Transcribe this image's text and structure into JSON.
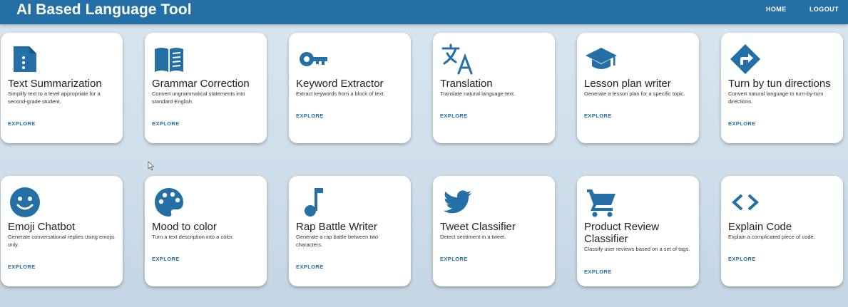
{
  "header": {
    "title": "AI Based Language Tool",
    "nav": {
      "home": "HOME",
      "logout": "LOGOUT"
    },
    "color": "#2470a6"
  },
  "cards": [
    {
      "icon": "document-list-icon",
      "title": "Text Summarization",
      "description": "Simplify text to a level appropriate for a second-grade student.",
      "action": "EXPLORE"
    },
    {
      "icon": "open-book-icon",
      "title": "Grammar Correction",
      "description": "Convert ungrammatical statements into standard English.",
      "action": "EXPLORE"
    },
    {
      "icon": "key-icon",
      "title": "Keyword Extractor",
      "description": "Extract keywords from a block of text.",
      "action": "EXPLORE"
    },
    {
      "icon": "translate-icon",
      "title": "Translation",
      "description": "Translate natural language text.",
      "action": "EXPLORE"
    },
    {
      "icon": "graduation-cap-icon",
      "title": "Lesson plan writer",
      "description": "Generate a lesson plan for a specific topic.",
      "action": "EXPLORE"
    },
    {
      "icon": "directions-icon",
      "title": "Turn by tun directions",
      "description": "Convert natural language to turn-by-turn directions.",
      "action": "EXPLORE"
    },
    {
      "icon": "smiley-face-icon",
      "title": "Emoji Chatbot",
      "description": "Generate conversational replies using emojis only.",
      "action": "EXPLORE"
    },
    {
      "icon": "palette-icon",
      "title": "Mood to color",
      "description": "Turn a text description into a color.",
      "action": "EXPLORE"
    },
    {
      "icon": "music-note-icon",
      "title": "Rap Battle Writer",
      "description": "Generate a rap battle between two characters.",
      "action": "EXPLORE"
    },
    {
      "icon": "twitter-bird-icon",
      "title": "Tweet Classifier",
      "description": "Detect sentiment in a tweet.",
      "action": "EXPLORE"
    },
    {
      "icon": "shopping-cart-icon",
      "title": "Product Review Classifier",
      "description": "Classify user reviews based on a set of tags.",
      "action": "EXPLORE"
    },
    {
      "icon": "code-brackets-icon",
      "title": "Explain Code",
      "description": "Explain a complicated piece of code.",
      "action": "EXPLORE"
    }
  ]
}
